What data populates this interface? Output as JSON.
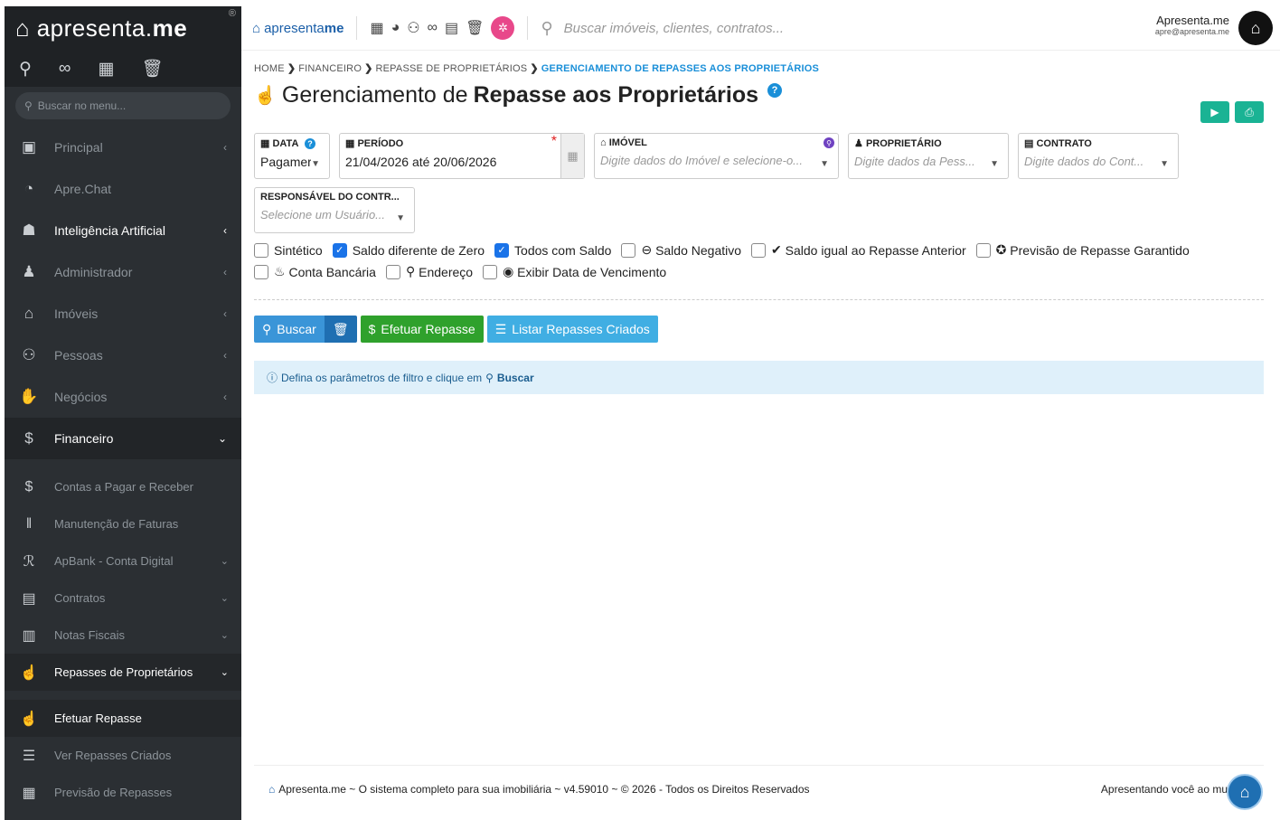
{
  "sidebar": {
    "brand": "apresenta",
    "brand_bold": "me",
    "brand_dot": ".",
    "search_placeholder": "Buscar no menu...",
    "items": [
      {
        "label": "Principal",
        "icon": "dashboard-icon"
      },
      {
        "label": "Apre.Chat",
        "icon": "whatsapp-icon"
      },
      {
        "label": "Inteligência Artificial",
        "icon": "robot-icon"
      },
      {
        "label": "Administrador",
        "icon": "user-tie-icon"
      },
      {
        "label": "Imóveis",
        "icon": "home-icon"
      },
      {
        "label": "Pessoas",
        "icon": "people-icon"
      },
      {
        "label": "Negócios",
        "icon": "handshake-icon"
      },
      {
        "label": "Financeiro",
        "icon": "dollar-circle-icon"
      }
    ],
    "financeiro_sub": [
      {
        "label": "Contas a Pagar e Receber",
        "icon": "dollar-icon"
      },
      {
        "label": "Manutenção de Faturas",
        "icon": "barcode-icon"
      },
      {
        "label": "ApBank - Conta Digital",
        "icon": "apbank-icon"
      },
      {
        "label": "Contratos",
        "icon": "contract-icon"
      },
      {
        "label": "Notas Fiscais",
        "icon": "invoice-icon"
      },
      {
        "label": "Repasses de Proprietários",
        "icon": "hand-coin-icon"
      }
    ],
    "repasses_sub": [
      {
        "label": "Efetuar Repasse",
        "icon": "hand-coin-icon"
      },
      {
        "label": "Ver Repasses Criados",
        "icon": "list-icon"
      },
      {
        "label": "Previsão de Repasses",
        "icon": "calendar-clock-icon"
      }
    ]
  },
  "topbar": {
    "brand": "apresenta",
    "brand_bold": "me",
    "search_placeholder": "Buscar imóveis, clientes, contratos...",
    "user_name": "Apresenta.me",
    "user_email": "apre@apresenta.me"
  },
  "breadcrumb": {
    "home": "HOME",
    "financeiro": "FINANCEIRO",
    "repasse": "REPASSE DE PROPRIETÁRIOS",
    "current": "GERENCIAMENTO DE REPASSES AOS PROPRIETÁRIOS"
  },
  "page": {
    "title_prefix": "Gerenciamento de",
    "title_bold": "Repasse aos Proprietários"
  },
  "filters": {
    "data_label": "DATA",
    "data_value": "Pagamer",
    "periodo_label": "PERÍODO",
    "periodo_value": "21/04/2026 até 20/06/2026",
    "imovel_label": "IMÓVEL",
    "imovel_placeholder": "Digite dados do Imóvel e selecione-o...",
    "proprietario_label": "PROPRIETÁRIO",
    "proprietario_placeholder": "Digite dados da Pess...",
    "contrato_label": "CONTRATO",
    "contrato_placeholder": "Digite dados do Cont...",
    "responsavel_label": "RESPONSÁVEL DO CONTR...",
    "responsavel_placeholder": "Selecione um Usuário..."
  },
  "checks_row1": [
    {
      "label": "Sintético",
      "checked": false
    },
    {
      "label": "Saldo diferente de Zero",
      "checked": true
    },
    {
      "label": "Todos com Saldo",
      "checked": true
    },
    {
      "label": "Saldo Negativo",
      "checked": false
    },
    {
      "label": "Saldo igual ao Repasse Anterior",
      "checked": false
    },
    {
      "label": "Previsão de Repasse Garantido",
      "checked": false
    }
  ],
  "checks_row2": [
    {
      "label": "Conta Bancária",
      "checked": false
    },
    {
      "label": "Endereço",
      "checked": false
    },
    {
      "label": "Exibir Data de Vencimento",
      "checked": false
    }
  ],
  "buttons": {
    "buscar": "Buscar",
    "efetuar": "Efetuar Repasse",
    "listar": "Listar Repasses Criados"
  },
  "info": {
    "text": "Defina os parâmetros de filtro e clique em",
    "link": "Buscar"
  },
  "footer": {
    "left": "Apresenta.me ~ O sistema completo para sua imobiliária ~ v4.59010 ~ © 2026 - Todos os Direitos Reservados",
    "right": "Apresentando você ao mu"
  }
}
